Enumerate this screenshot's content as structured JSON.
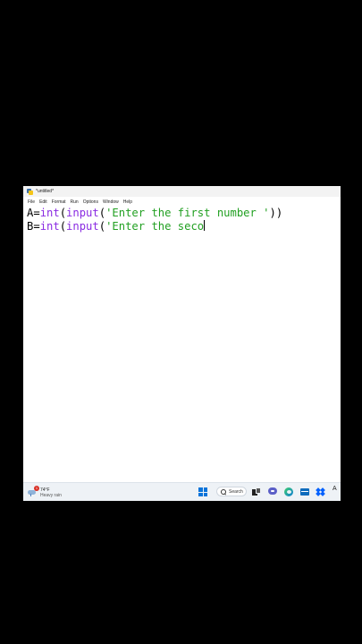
{
  "window": {
    "title": "*untitled*"
  },
  "menu": {
    "items": [
      "File",
      "Edit",
      "Format",
      "Run",
      "Options",
      "Window",
      "Help"
    ]
  },
  "editor": {
    "line1": {
      "var": "A=",
      "int_fn": "int",
      "open1": "(",
      "input_fn": "input",
      "open2": "(",
      "string": "'Enter the first number '",
      "close": "))"
    },
    "line2": {
      "var": "B=",
      "int_fn": "int",
      "open1": "(",
      "input_fn": "input",
      "open2": "(",
      "string": "'Enter the seco"
    },
    "colors": {
      "keyword": "#8a2be2",
      "string": "#22a022",
      "text": "#000000"
    }
  },
  "taskbar": {
    "weather_temp": "74°F",
    "weather_desc": "Heavy rain",
    "weather_badge": "1",
    "search_label": "Search",
    "icons": [
      "start-icon",
      "search-icon",
      "task-view-icon",
      "chat-icon",
      "edge-icon",
      "mail-icon",
      "dropbox-icon",
      "font-icon"
    ],
    "font_icon_glyph": "A"
  }
}
